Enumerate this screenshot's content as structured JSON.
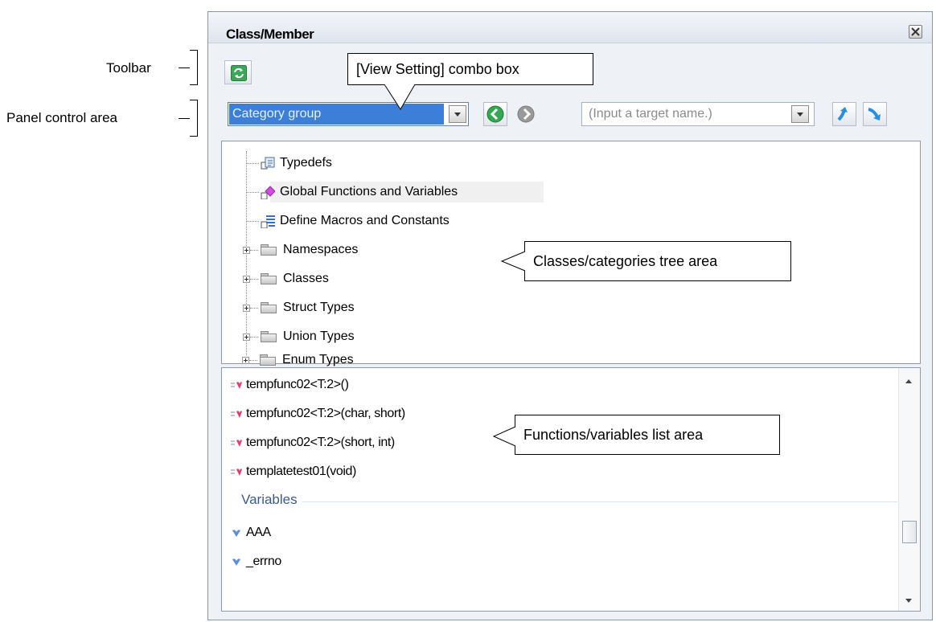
{
  "panel": {
    "title": "Class/Member"
  },
  "control": {
    "view_setting_value": "Category group",
    "target_placeholder": "(Input a target name.)"
  },
  "tree": {
    "items": [
      {
        "label": "Typedefs",
        "icon": "typedef-icon",
        "expandable": false
      },
      {
        "label": "Global Functions and Variables",
        "icon": "global-functions-icon",
        "expandable": false
      },
      {
        "label": "Define Macros and Constants",
        "icon": "macro-icon",
        "expandable": false
      },
      {
        "label": "Namespaces",
        "icon": "folder-icon",
        "expandable": true
      },
      {
        "label": "Classes",
        "icon": "folder-icon",
        "expandable": true
      },
      {
        "label": "Struct Types",
        "icon": "folder-icon",
        "expandable": true
      },
      {
        "label": "Union Types",
        "icon": "folder-icon",
        "expandable": true
      },
      {
        "label": "Enum Types",
        "icon": "folder-icon",
        "expandable": true
      }
    ]
  },
  "list": {
    "functions": [
      {
        "label": "tempfunc02<T:2>()",
        "icon": "function-icon"
      },
      {
        "label": "tempfunc02<T:2>(char, short)",
        "icon": "function-icon"
      },
      {
        "label": "tempfunc02<T:2>(short, int)",
        "icon": "function-icon"
      },
      {
        "label": "templatetest01(void)",
        "icon": "function-icon"
      }
    ],
    "variables_header": "Variables",
    "variables": [
      {
        "label": "AAA",
        "icon": "variable-icon"
      },
      {
        "label": "_errno",
        "icon": "variable-icon"
      }
    ]
  },
  "annotations": {
    "toolbar": "Toolbar",
    "panel_control_area": "Panel control area",
    "view_setting_combo": "[View Setting] combo box",
    "tree_area": "Classes/categories tree area",
    "list_area": "Functions/variables list area"
  },
  "colors": {
    "selection": "#3b7fd8",
    "nav_back": "#2ea043",
    "nav_jump": "#2b8fe0"
  }
}
